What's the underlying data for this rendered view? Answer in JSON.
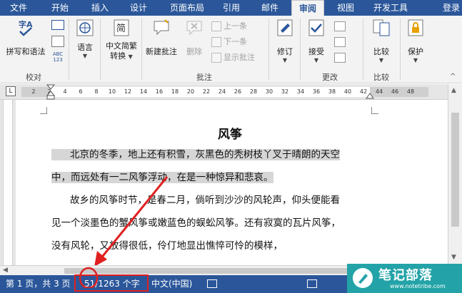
{
  "tabs": {
    "file": "文件",
    "items": [
      "开始",
      "插入",
      "设计",
      "页面布局",
      "引用",
      "邮件",
      "审阅",
      "视图",
      "开发工具"
    ],
    "active": "审阅",
    "login": "登录"
  },
  "ribbon": {
    "proofing": {
      "spell": "拼写和语法",
      "group": "校对"
    },
    "language": {
      "label": "语言"
    },
    "chinese": {
      "label_line1": "中文简繁",
      "label_line2": "转换"
    },
    "comments": {
      "new": "新建批注",
      "delete": "删除",
      "prev": "上一条",
      "next": "下一条",
      "show": "显示批注",
      "group": "批注"
    },
    "tracking": {
      "revise": "修订"
    },
    "changes": {
      "accept": "接受",
      "group": "更改"
    },
    "compare": {
      "label": "比较",
      "group": "比较"
    },
    "protect": {
      "label": "保护"
    }
  },
  "ruler": {
    "ticks": [
      "2",
      "2",
      "4",
      "6",
      "8",
      "10",
      "12",
      "14",
      "16",
      "18",
      "20",
      "22",
      "24",
      "26",
      "28",
      "30",
      "32",
      "34",
      "36",
      "38",
      "40",
      "42",
      "44",
      "46",
      "48"
    ],
    "tab_marker": "L"
  },
  "document": {
    "title": "风筝",
    "lines": [
      "北京的冬季，地上还有积雪，灰黑色的秃树枝丫叉于晴朗的天空",
      "中，而远处有一二风筝浮动，在是一种惊异和悲哀。",
      "故乡的风筝时节，是春二月，倘听到沙沙的风轮声，仰头便能看",
      "见一个淡墨色的蟹风筝或嫩蓝色的蜈蚣风筝。还有寂寞的瓦片风筝，",
      "没有风轮，又放得很低，伶仃地显出憔悴可怜的模样，"
    ]
  },
  "status": {
    "page": "第 1 页，共 3 页",
    "words": "51/1263 个字",
    "language": "中文(中国)"
  },
  "watermark": {
    "name": "笔记部落",
    "url": "www.notetribe.com"
  },
  "colors": {
    "accent": "#2b579a",
    "highlight": "#e02020",
    "watermark": "#23a3a8"
  }
}
